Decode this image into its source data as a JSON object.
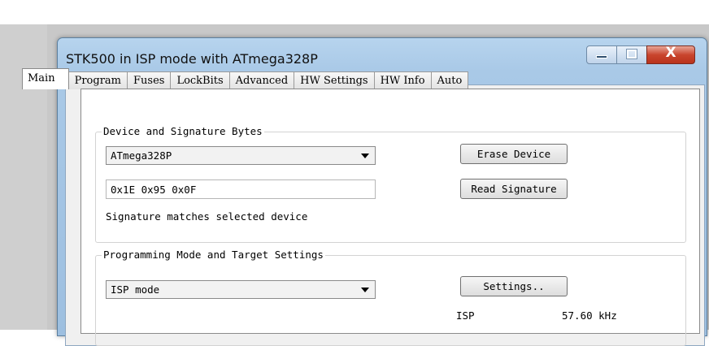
{
  "window": {
    "title": "STK500 in ISP mode with ATmega328P",
    "caption_icons": [
      "minimize-icon",
      "maximize-icon",
      "close-icon"
    ],
    "close_glyph": "X"
  },
  "tabs": [
    {
      "label": "Main",
      "active": true
    },
    {
      "label": "Program",
      "active": false
    },
    {
      "label": "Fuses",
      "active": false
    },
    {
      "label": "LockBits",
      "active": false
    },
    {
      "label": "Advanced",
      "active": false
    },
    {
      "label": "HW Settings",
      "active": false
    },
    {
      "label": "HW Info",
      "active": false
    },
    {
      "label": "Auto",
      "active": false
    }
  ],
  "device_group": {
    "legend": "Device and Signature Bytes",
    "device_select": "ATmega328P",
    "signature_value": "0x1E 0x95 0x0F",
    "erase_button": "Erase Device",
    "read_signature_button": "Read Signature",
    "status": "Signature matches selected device"
  },
  "programming_group": {
    "legend": "Programming Mode and Target Settings",
    "mode_select": "ISP mode",
    "settings_button": "Settings..",
    "mode_label": "ISP",
    "frequency": "57.60 kHz"
  },
  "colors": {
    "title_bar": "#a9c9e7",
    "close_button": "#c9452e",
    "panel_background": "#ffffff"
  }
}
